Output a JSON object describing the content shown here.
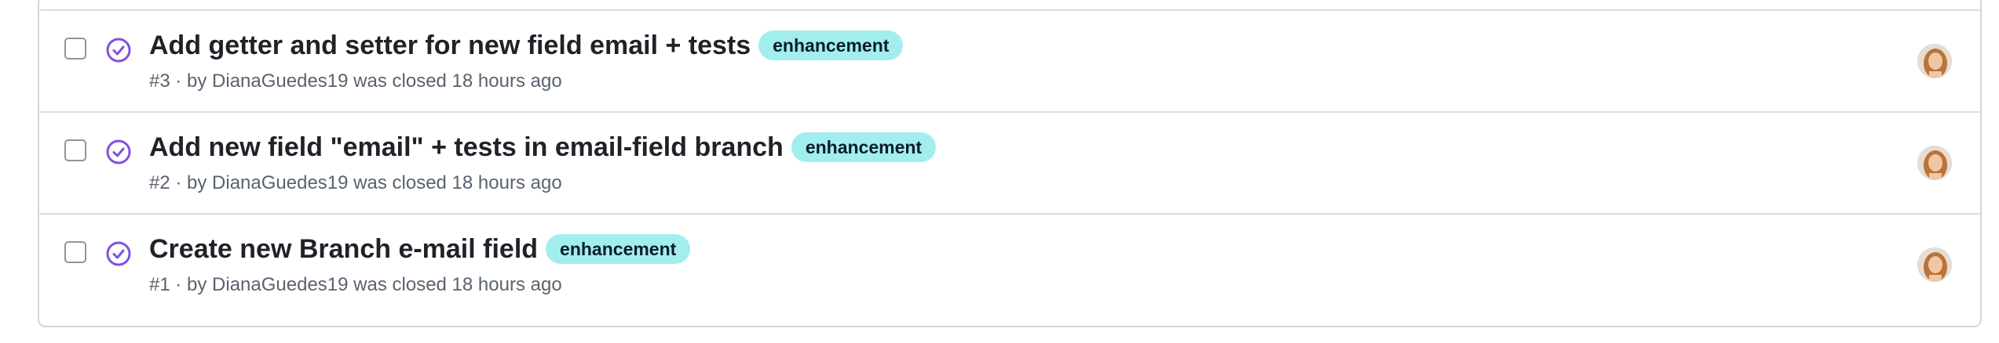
{
  "issues": [
    {
      "title": "Add getter and setter for new field email + tests",
      "label": "enhancement",
      "meta": "#3 · by DianaGuedes19 was closed 18 hours ago"
    },
    {
      "title": "Add new field \"email\" + tests in email-field branch",
      "label": "enhancement",
      "meta": "#2 · by DianaGuedes19 was closed 18 hours ago"
    },
    {
      "title": "Create new Branch e-mail field",
      "label": "enhancement",
      "meta": "#1 · by DianaGuedes19 was closed 18 hours ago"
    }
  ],
  "colors": {
    "closed_icon": "#8250df",
    "label_background": "#a2eeef",
    "border": "#d0d7de"
  },
  "icons": {
    "state": "issue-closed-icon",
    "avatar": "user-avatar"
  }
}
